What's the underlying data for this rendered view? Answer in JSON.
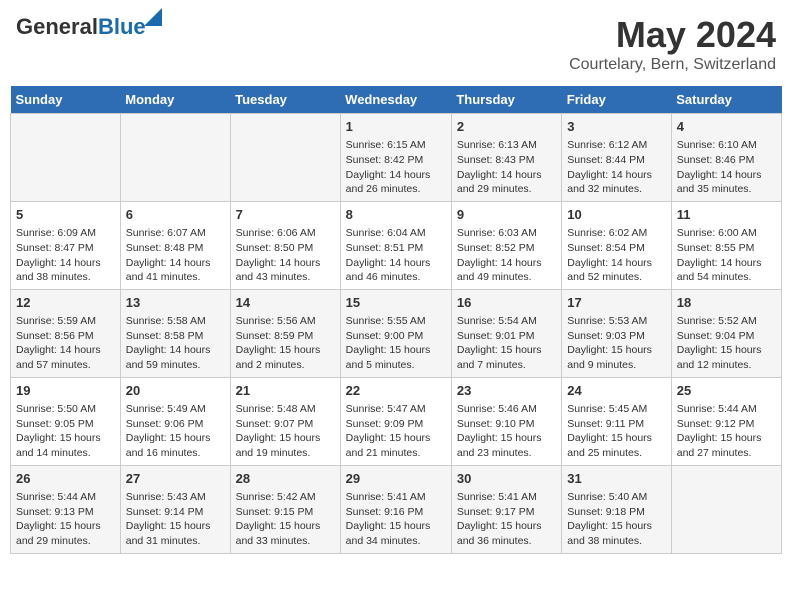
{
  "header": {
    "logo_general": "General",
    "logo_blue": "Blue",
    "month_year": "May 2024",
    "location": "Courtelary, Bern, Switzerland"
  },
  "days_of_week": [
    "Sunday",
    "Monday",
    "Tuesday",
    "Wednesday",
    "Thursday",
    "Friday",
    "Saturday"
  ],
  "weeks": [
    [
      {
        "day": "",
        "content": ""
      },
      {
        "day": "",
        "content": ""
      },
      {
        "day": "",
        "content": ""
      },
      {
        "day": "1",
        "content": "Sunrise: 6:15 AM\nSunset: 8:42 PM\nDaylight: 14 hours and 26 minutes."
      },
      {
        "day": "2",
        "content": "Sunrise: 6:13 AM\nSunset: 8:43 PM\nDaylight: 14 hours and 29 minutes."
      },
      {
        "day": "3",
        "content": "Sunrise: 6:12 AM\nSunset: 8:44 PM\nDaylight: 14 hours and 32 minutes."
      },
      {
        "day": "4",
        "content": "Sunrise: 6:10 AM\nSunset: 8:46 PM\nDaylight: 14 hours and 35 minutes."
      }
    ],
    [
      {
        "day": "5",
        "content": "Sunrise: 6:09 AM\nSunset: 8:47 PM\nDaylight: 14 hours and 38 minutes."
      },
      {
        "day": "6",
        "content": "Sunrise: 6:07 AM\nSunset: 8:48 PM\nDaylight: 14 hours and 41 minutes."
      },
      {
        "day": "7",
        "content": "Sunrise: 6:06 AM\nSunset: 8:50 PM\nDaylight: 14 hours and 43 minutes."
      },
      {
        "day": "8",
        "content": "Sunrise: 6:04 AM\nSunset: 8:51 PM\nDaylight: 14 hours and 46 minutes."
      },
      {
        "day": "9",
        "content": "Sunrise: 6:03 AM\nSunset: 8:52 PM\nDaylight: 14 hours and 49 minutes."
      },
      {
        "day": "10",
        "content": "Sunrise: 6:02 AM\nSunset: 8:54 PM\nDaylight: 14 hours and 52 minutes."
      },
      {
        "day": "11",
        "content": "Sunrise: 6:00 AM\nSunset: 8:55 PM\nDaylight: 14 hours and 54 minutes."
      }
    ],
    [
      {
        "day": "12",
        "content": "Sunrise: 5:59 AM\nSunset: 8:56 PM\nDaylight: 14 hours and 57 minutes."
      },
      {
        "day": "13",
        "content": "Sunrise: 5:58 AM\nSunset: 8:58 PM\nDaylight: 14 hours and 59 minutes."
      },
      {
        "day": "14",
        "content": "Sunrise: 5:56 AM\nSunset: 8:59 PM\nDaylight: 15 hours and 2 minutes."
      },
      {
        "day": "15",
        "content": "Sunrise: 5:55 AM\nSunset: 9:00 PM\nDaylight: 15 hours and 5 minutes."
      },
      {
        "day": "16",
        "content": "Sunrise: 5:54 AM\nSunset: 9:01 PM\nDaylight: 15 hours and 7 minutes."
      },
      {
        "day": "17",
        "content": "Sunrise: 5:53 AM\nSunset: 9:03 PM\nDaylight: 15 hours and 9 minutes."
      },
      {
        "day": "18",
        "content": "Sunrise: 5:52 AM\nSunset: 9:04 PM\nDaylight: 15 hours and 12 minutes."
      }
    ],
    [
      {
        "day": "19",
        "content": "Sunrise: 5:50 AM\nSunset: 9:05 PM\nDaylight: 15 hours and 14 minutes."
      },
      {
        "day": "20",
        "content": "Sunrise: 5:49 AM\nSunset: 9:06 PM\nDaylight: 15 hours and 16 minutes."
      },
      {
        "day": "21",
        "content": "Sunrise: 5:48 AM\nSunset: 9:07 PM\nDaylight: 15 hours and 19 minutes."
      },
      {
        "day": "22",
        "content": "Sunrise: 5:47 AM\nSunset: 9:09 PM\nDaylight: 15 hours and 21 minutes."
      },
      {
        "day": "23",
        "content": "Sunrise: 5:46 AM\nSunset: 9:10 PM\nDaylight: 15 hours and 23 minutes."
      },
      {
        "day": "24",
        "content": "Sunrise: 5:45 AM\nSunset: 9:11 PM\nDaylight: 15 hours and 25 minutes."
      },
      {
        "day": "25",
        "content": "Sunrise: 5:44 AM\nSunset: 9:12 PM\nDaylight: 15 hours and 27 minutes."
      }
    ],
    [
      {
        "day": "26",
        "content": "Sunrise: 5:44 AM\nSunset: 9:13 PM\nDaylight: 15 hours and 29 minutes."
      },
      {
        "day": "27",
        "content": "Sunrise: 5:43 AM\nSunset: 9:14 PM\nDaylight: 15 hours and 31 minutes."
      },
      {
        "day": "28",
        "content": "Sunrise: 5:42 AM\nSunset: 9:15 PM\nDaylight: 15 hours and 33 minutes."
      },
      {
        "day": "29",
        "content": "Sunrise: 5:41 AM\nSunset: 9:16 PM\nDaylight: 15 hours and 34 minutes."
      },
      {
        "day": "30",
        "content": "Sunrise: 5:41 AM\nSunset: 9:17 PM\nDaylight: 15 hours and 36 minutes."
      },
      {
        "day": "31",
        "content": "Sunrise: 5:40 AM\nSunset: 9:18 PM\nDaylight: 15 hours and 38 minutes."
      },
      {
        "day": "",
        "content": ""
      }
    ]
  ]
}
